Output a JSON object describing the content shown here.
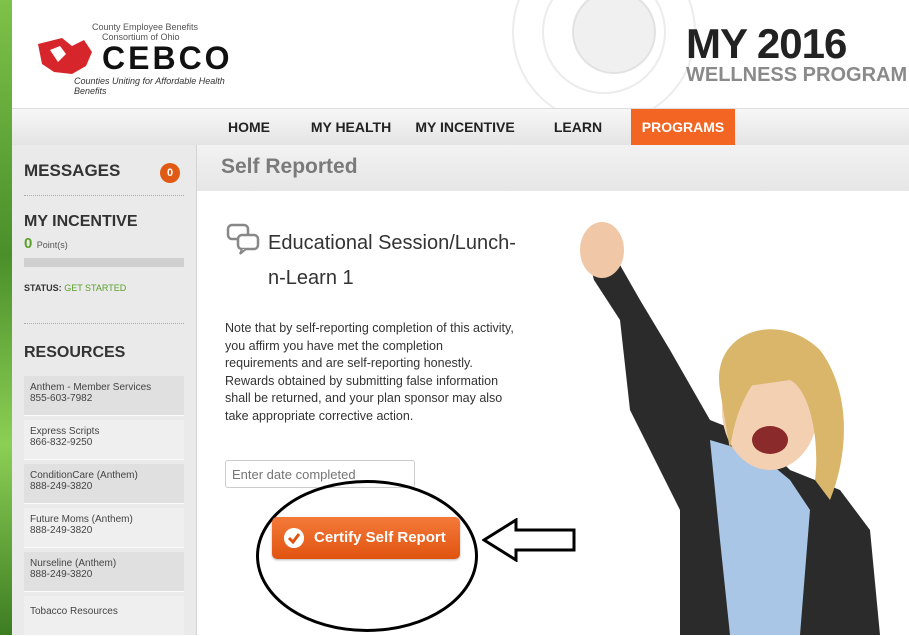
{
  "header": {
    "org_line1": "County Employee Benefits",
    "org_line2": "Consortium of Ohio",
    "logo_word": "CEBCO",
    "tagline": "Counties Uniting for Affordable Health Benefits",
    "program_year": "MY 2016",
    "program_name": "WELLNESS PROGRAM"
  },
  "nav": {
    "items": [
      {
        "label": "HOME"
      },
      {
        "label": "MY HEALTH"
      },
      {
        "label": "MY INCENTIVE"
      },
      {
        "label": "LEARN"
      },
      {
        "label": "PROGRAMS"
      }
    ],
    "active": "PROGRAMS"
  },
  "sidebar": {
    "messages_title": "MESSAGES",
    "messages_count": "0",
    "incentive_title": "MY INCENTIVE",
    "points_value": "0",
    "points_label": "Point(s)",
    "incentive_progress": 0,
    "status_label": "STATUS:",
    "status_value": "GET STARTED",
    "resources_title": "RESOURCES",
    "resources": [
      {
        "name": "Anthem - Member Services",
        "phone": "855-603-7982"
      },
      {
        "name": "Express Scripts",
        "phone": "866-832-9250"
      },
      {
        "name": "ConditionCare (Anthem)",
        "phone": "888-249-3820"
      },
      {
        "name": "Future Moms (Anthem)",
        "phone": "888-249-3820"
      },
      {
        "name": "Nurseline (Anthem)",
        "phone": "888-249-3820"
      },
      {
        "name": "Tobacco Resources",
        "phone": ""
      }
    ]
  },
  "main": {
    "section_title": "Self Reported",
    "activity_title": "Educational Session/Lunch-n-Learn 1",
    "note": "Note that by self-reporting completion of this activity, you affirm you have met the completion requirements and are self-reporting honestly. Rewards obtained by submitting false information shall be returned, and your plan sponsor may also take appropriate corrective action.",
    "date_placeholder": "Enter date completed",
    "certify_label": "Certify Self Report"
  },
  "colors": {
    "accent": "#f26522",
    "points_green": "#5aa02c",
    "badge": "#e05a14"
  }
}
